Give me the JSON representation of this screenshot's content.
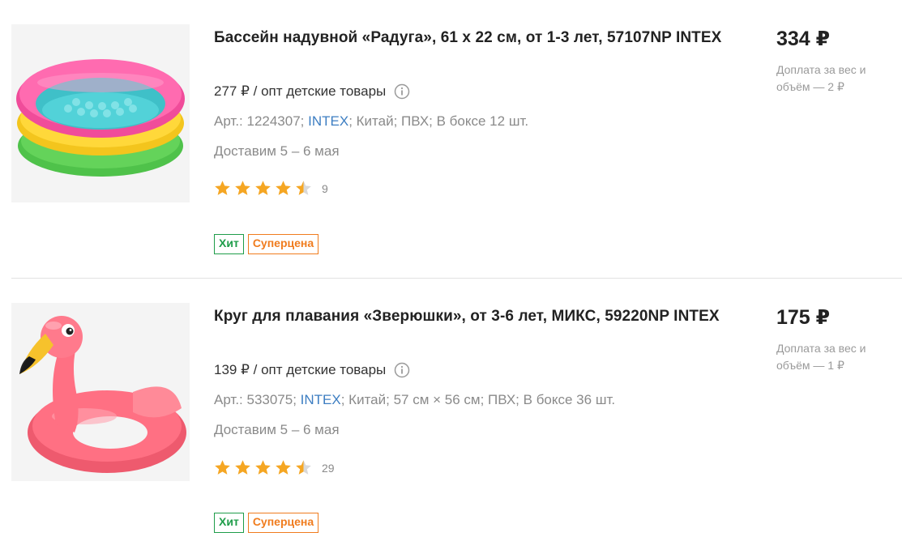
{
  "products": [
    {
      "title": "Бассейн надувной «Радуга», 61 х 22 см, от 1-3 лет, 57107NP INTEX",
      "price_opt": "277 ₽ / опт детские товары",
      "article_prefix": "Арт.: 1224307; ",
      "brand": "INTEX",
      "article_suffix": "; Китай; ПВХ; В боксе 12 шт.",
      "delivery": "Доставим 5 – 6 мая",
      "rating": 4.5,
      "reviews": "9",
      "badges": {
        "hit": "Хит",
        "super": "Суперцена"
      },
      "price": "334 ₽",
      "surcharge": "Доплата за вес и объём — 2 ₽",
      "image_icon": "inflatable-pool-image"
    },
    {
      "title": "Круг для плавания «Зверюшки», от 3-6 лет, МИКС, 59220NP INTEX",
      "price_opt": "139 ₽ / опт детские товары",
      "article_prefix": "Арт.: 533075; ",
      "brand": "INTEX",
      "article_suffix": "; Китай; 57 см × 56 см; ПВХ; В боксе 36 шт.",
      "delivery": "Доставим 5 – 6 мая",
      "rating": 4.5,
      "reviews": "29",
      "badges": {
        "hit": "Хит",
        "super": "Суперцена"
      },
      "price": "175 ₽",
      "surcharge": "Доплата за вес и объём — 1 ₽",
      "image_icon": "flamingo-swim-ring-image"
    }
  ],
  "colors": {
    "star": "#f5a623",
    "star_empty": "#d9d9d9",
    "hit": "#1f9d4a",
    "super": "#f07c1e",
    "brand_link": "#3d7ec2"
  }
}
